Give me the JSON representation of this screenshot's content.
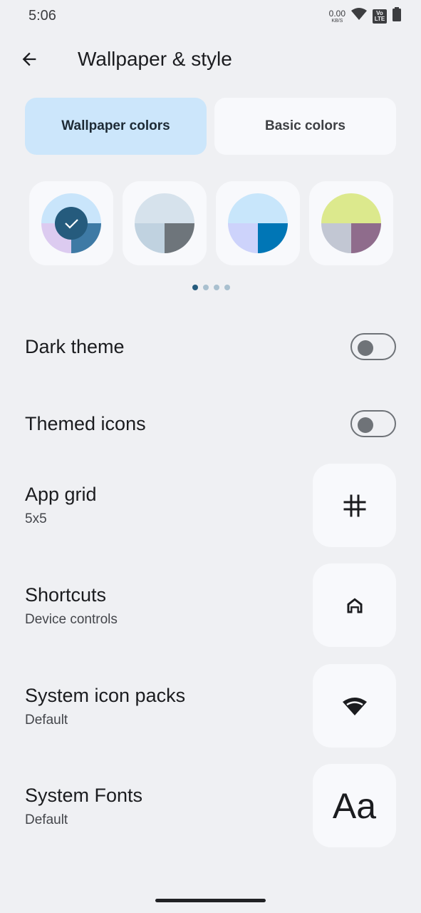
{
  "status": {
    "time": "5:06",
    "net_value": "0.00",
    "net_unit": "KB/S",
    "lte_top": "Vo",
    "lte_bottom": "LTE"
  },
  "header": {
    "title": "Wallpaper & style"
  },
  "tabs": [
    {
      "label": "Wallpaper colors",
      "active": true
    },
    {
      "label": "Basic colors",
      "active": false
    }
  ],
  "swatches": [
    {
      "top": "#c9e5fb",
      "bottom_left": "#dccbf0",
      "bottom_right": "#3e7aa5",
      "selected": true
    },
    {
      "top": "#d6e2ec",
      "bottom_left": "#c0d2e0",
      "bottom_right": "#6e757b",
      "selected": false
    },
    {
      "top": "#c8e6fb",
      "bottom_left": "#cdd3fb",
      "bottom_right": "#0076b6",
      "selected": false
    },
    {
      "top": "#dce98d",
      "bottom_left": "#c2c7d3",
      "bottom_right": "#8f6c8c",
      "selected": false
    }
  ],
  "pager": {
    "count": 4,
    "active_index": 0
  },
  "settings": {
    "dark_theme": {
      "label": "Dark theme",
      "enabled": false
    },
    "themed_icons": {
      "label": "Themed icons",
      "enabled": false
    },
    "app_grid": {
      "label": "App grid",
      "value": "5x5",
      "icon": "grid-icon"
    },
    "shortcuts": {
      "label": "Shortcuts",
      "value": "Device controls",
      "icon": "home-icon"
    },
    "icon_packs": {
      "label": "System icon packs",
      "value": "Default",
      "icon": "wifi-icon"
    },
    "fonts": {
      "label": "System Fonts",
      "value": "Default",
      "preview": "Aa"
    }
  },
  "colors": {
    "selected_check_bg": "#255b7d",
    "active_tab": "#cce6fb"
  }
}
